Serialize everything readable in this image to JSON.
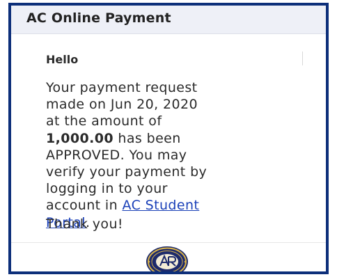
{
  "header": {
    "title": "AC Online Payment"
  },
  "email": {
    "greeting": "Hello",
    "message": {
      "line1": "Your payment request",
      "line2": "made on Jun 20, 2020",
      "line3": "at the amount of",
      "amount": "1,000.00",
      "line4_rest": " has been",
      "line5": "APPROVED. You may",
      "line6": "verify your payment by",
      "line7": "logging in to your",
      "line8_pre": "account in ",
      "link_part1": "AC Student",
      "link_part2": "Portal",
      "line9_post": "."
    },
    "closing": "Thank you!"
  },
  "colors": {
    "frame_border": "#0d2f7a",
    "link": "#1a40b8",
    "header_bg": "#eef0f7"
  },
  "icons": {
    "seal": "school-seal-logo"
  }
}
